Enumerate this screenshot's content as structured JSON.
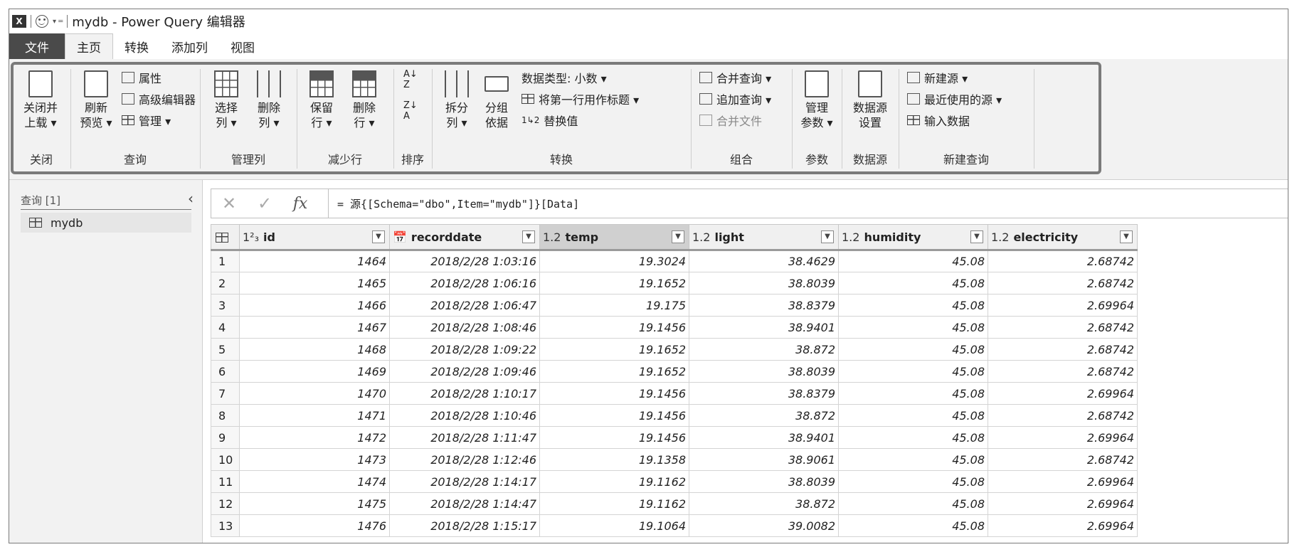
{
  "titlebar": {
    "logo": "X",
    "app_title": "mydb - Power Query 编辑器"
  },
  "menu": {
    "tabs": [
      "文件",
      "主页",
      "转换",
      "添加列",
      "视图"
    ],
    "active": "主页"
  },
  "ribbon": {
    "close": {
      "btn": "关闭并\n上载 ▾",
      "label": "关闭"
    },
    "query": {
      "refresh": "刷新\n预览 ▾",
      "properties": "属性",
      "advanced": "高级编辑器",
      "manage": "管理 ▾",
      "label": "查询"
    },
    "manage_cols": {
      "choose": "选择\n列 ▾",
      "remove": "删除\n列 ▾",
      "label": "管理列"
    },
    "reduce_rows": {
      "keep": "保留\n行 ▾",
      "remove": "删除\n行 ▾",
      "label": "减少行"
    },
    "sort": {
      "label": "排序"
    },
    "transform": {
      "split": "拆分\n列 ▾",
      "group": "分组\n依据",
      "datatype": "数据类型: 小数 ▾",
      "first_row": "将第一行用作标题 ▾",
      "replace": "替换值",
      "label": "转换"
    },
    "combine": {
      "merge": "合并查询 ▾",
      "append": "追加查询 ▾",
      "combine_files": "合并文件",
      "label": "组合"
    },
    "params": {
      "manage": "管理\n参数 ▾",
      "label": "参数"
    },
    "datasource": {
      "settings": "数据源\n设置",
      "label": "数据源"
    },
    "newquery": {
      "new_source": "新建源 ▾",
      "recent": "最近使用的源 ▾",
      "enter": "输入数据",
      "label": "新建查询"
    }
  },
  "leftpane": {
    "header": "查询 [1]",
    "item": "mydb"
  },
  "formula": {
    "text": "= 源{[Schema=\"dbo\",Item=\"mydb\"]}[Data]"
  },
  "table": {
    "columns": [
      {
        "type": "1²₃",
        "name": "id"
      },
      {
        "type": "📅",
        "name": "recorddate"
      },
      {
        "type": "1.2",
        "name": "temp"
      },
      {
        "type": "1.2",
        "name": "light"
      },
      {
        "type": "1.2",
        "name": "humidity"
      },
      {
        "type": "1.2",
        "name": "electricity"
      }
    ],
    "rows": [
      [
        "1464",
        "2018/2/28 1:03:16",
        "19.3024",
        "38.4629",
        "45.08",
        "2.68742"
      ],
      [
        "1465",
        "2018/2/28 1:06:16",
        "19.1652",
        "38.8039",
        "45.08",
        "2.68742"
      ],
      [
        "1466",
        "2018/2/28 1:06:47",
        "19.175",
        "38.8379",
        "45.08",
        "2.69964"
      ],
      [
        "1467",
        "2018/2/28 1:08:46",
        "19.1456",
        "38.9401",
        "45.08",
        "2.68742"
      ],
      [
        "1468",
        "2018/2/28 1:09:22",
        "19.1652",
        "38.872",
        "45.08",
        "2.68742"
      ],
      [
        "1469",
        "2018/2/28 1:09:46",
        "19.1652",
        "38.8039",
        "45.08",
        "2.68742"
      ],
      [
        "1470",
        "2018/2/28 1:10:17",
        "19.1456",
        "38.8379",
        "45.08",
        "2.69964"
      ],
      [
        "1471",
        "2018/2/28 1:10:46",
        "19.1456",
        "38.872",
        "45.08",
        "2.68742"
      ],
      [
        "1472",
        "2018/2/28 1:11:47",
        "19.1456",
        "38.9401",
        "45.08",
        "2.69964"
      ],
      [
        "1473",
        "2018/2/28 1:12:46",
        "19.1358",
        "38.9061",
        "45.08",
        "2.68742"
      ],
      [
        "1474",
        "2018/2/28 1:14:17",
        "19.1162",
        "38.8039",
        "45.08",
        "2.69964"
      ],
      [
        "1475",
        "2018/2/28 1:14:47",
        "19.1162",
        "38.872",
        "45.08",
        "2.69964"
      ],
      [
        "1476",
        "2018/2/28 1:15:17",
        "19.1064",
        "39.0082",
        "45.08",
        "2.69964"
      ]
    ]
  }
}
